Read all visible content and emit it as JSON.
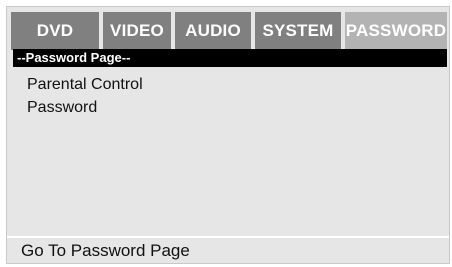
{
  "tabs": [
    {
      "label": "DVD",
      "active": false
    },
    {
      "label": "VIDEO",
      "active": false
    },
    {
      "label": "AUDIO",
      "active": false
    },
    {
      "label": "SYSTEM",
      "active": false
    },
    {
      "label": "PASSWORD",
      "active": true
    }
  ],
  "page": {
    "header": "--Password Page--",
    "items": [
      {
        "label": "Parental Control"
      },
      {
        "label": "Password"
      }
    ]
  },
  "status": {
    "text": "Go To Password Page"
  },
  "colors": {
    "panel_bg": "#e6e6e6",
    "tab_bg": "#808080",
    "tab_active_bg": "#b3b3b3",
    "header_bg": "#000000"
  }
}
